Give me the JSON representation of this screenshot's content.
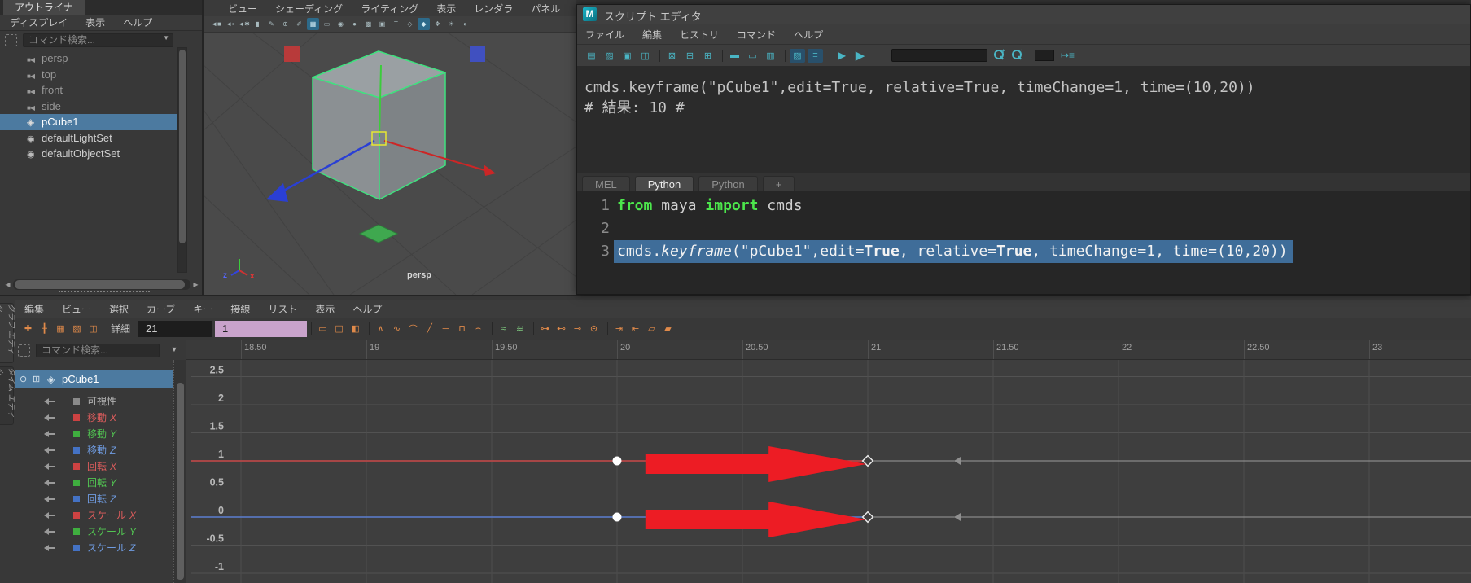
{
  "colors": {
    "selection_blue": "#4c7aa0",
    "code_selection": "#3f6d99",
    "keyword_green": "#4ce64c",
    "annotation_arrow_red": "#ed1c24",
    "curve_red": "#c84848",
    "curve_blue": "#5b7fd0",
    "icon_teal": "#4ab5c4",
    "icon_orange": "#e08a4a",
    "stat_field_purple": "#c9a3cb"
  },
  "outliner": {
    "tab": "アウトライナ",
    "menus": [
      "ディスプレイ",
      "表示",
      "ヘルプ"
    ],
    "search_placeholder": "コマンド検索...",
    "items": [
      {
        "label": "persp",
        "icon": "camera",
        "dim": true
      },
      {
        "label": "top",
        "icon": "camera",
        "dim": true
      },
      {
        "label": "front",
        "icon": "camera",
        "dim": true
      },
      {
        "label": "side",
        "icon": "camera",
        "dim": true
      },
      {
        "label": "pCube1",
        "icon": "mesh",
        "selected": true
      },
      {
        "label": "defaultLightSet",
        "icon": "set"
      },
      {
        "label": "defaultObjectSet",
        "icon": "set"
      }
    ]
  },
  "viewport": {
    "menus": [
      "ビュー",
      "シェーディング",
      "ライティング",
      "表示",
      "レンダラ",
      "パネル"
    ],
    "toolbar_icons": [
      {
        "name": "camera-select-icon",
        "glyph": "◄■"
      },
      {
        "name": "camera-lock-icon",
        "glyph": "◄▪"
      },
      {
        "name": "camera-attributes-icon",
        "glyph": "◄✱"
      },
      {
        "name": "bookmark-icon",
        "glyph": "▮"
      },
      {
        "name": "image-plane-icon",
        "glyph": "✎"
      },
      {
        "name": "pan-zoom-icon",
        "glyph": "⊕"
      },
      {
        "name": "grease-pencil-icon",
        "glyph": "✐"
      },
      {
        "name": "grid-icon",
        "glyph": "▦",
        "active": true
      },
      {
        "name": "film-gate-icon",
        "glyph": "▭"
      },
      {
        "name": "resolution-gate-icon",
        "glyph": "◉"
      },
      {
        "name": "gate-mask-icon",
        "glyph": "●"
      },
      {
        "name": "field-chart-icon",
        "glyph": "▩"
      },
      {
        "name": "safe-action-icon",
        "glyph": "▣"
      },
      {
        "name": "safe-title-icon",
        "glyph": "T"
      },
      {
        "name": "wireframe-cube-icon",
        "glyph": "◇"
      },
      {
        "name": "shaded-cube-icon",
        "glyph": "◆",
        "active": true
      },
      {
        "name": "textured-cube-icon",
        "glyph": "❖"
      },
      {
        "name": "use-all-lights-icon",
        "glyph": "☀"
      },
      {
        "name": "shadows-icon",
        "glyph": "◐"
      }
    ],
    "camera_label": "persp",
    "axis_labels": {
      "x": "x",
      "z": "z"
    }
  },
  "script_editor": {
    "title": "スクリプト エディタ",
    "menus": [
      "ファイル",
      "編集",
      "ヒストリ",
      "コマンド",
      "ヘルプ"
    ],
    "toolbar_icons": [
      {
        "name": "open-script-icon",
        "glyph": "▤"
      },
      {
        "name": "source-script-icon",
        "glyph": "▨"
      },
      {
        "name": "save-script-icon",
        "glyph": "▣"
      },
      {
        "name": "save-selected-icon",
        "glyph": "◫"
      },
      {
        "sep": true
      },
      {
        "name": "clear-history-icon",
        "glyph": "⊠"
      },
      {
        "name": "clear-input-icon",
        "glyph": "⊟"
      },
      {
        "name": "clear-all-icon",
        "glyph": "⊞"
      },
      {
        "sep": true
      },
      {
        "name": "echo-all-commands-icon",
        "glyph": "▬"
      },
      {
        "name": "suppress-results-icon",
        "glyph": "▭"
      },
      {
        "name": "suppress-info-icon",
        "glyph": "▥"
      },
      {
        "sep": true
      },
      {
        "name": "command-completion-icon",
        "glyph": "▧",
        "active": true
      },
      {
        "name": "line-numbers-icon",
        "glyph": "≡",
        "active": true
      },
      {
        "sep": true
      },
      {
        "name": "execute-line-icon",
        "glyph": "▶",
        "play": "small"
      },
      {
        "name": "execute-all-icon",
        "glyph": "▶",
        "play": "big"
      }
    ],
    "search_value": "",
    "history_lines": [
      "cmds.keyframe(\"pCube1\",edit=True, relative=True, timeChange=1, time=(10,20))",
      "# 結果: 10 #"
    ],
    "tabs": [
      {
        "label": "MEL"
      },
      {
        "label": "Python",
        "active": true
      },
      {
        "label": "Python"
      },
      {
        "label": "+"
      }
    ],
    "code_lines": [
      {
        "num": "1",
        "tokens": [
          {
            "t": "from",
            "s": "kw"
          },
          {
            "t": " maya ",
            "s": ""
          },
          {
            "t": "import",
            "s": "kw"
          },
          {
            "t": " cmds",
            "s": ""
          }
        ]
      },
      {
        "num": "2",
        "tokens": []
      },
      {
        "num": "3",
        "selected": true,
        "tokens": [
          {
            "t": "cmds.",
            "s": ""
          },
          {
            "t": "keyframe",
            "s": "it"
          },
          {
            "t": "(\"pCube1\",edit=",
            "s": ""
          },
          {
            "t": "True",
            "s": "b"
          },
          {
            "t": ", relative=",
            "s": ""
          },
          {
            "t": "True",
            "s": "b"
          },
          {
            "t": ", timeChange=1, time=(10,20))",
            "s": ""
          }
        ]
      }
    ]
  },
  "graph_editor": {
    "side_tabs": [
      {
        "label": "グラフ エディタ",
        "active": true
      },
      {
        "label": "タイム エディタ"
      }
    ],
    "menus": [
      "編集",
      "ビュー",
      "選択",
      "カーブ",
      "キー",
      "接線",
      "リスト",
      "表示",
      "ヘルプ"
    ],
    "toolbar": {
      "details_label": "詳細",
      "time_field": "21",
      "value_field": "1"
    },
    "toolbar_icons_left": [
      {
        "name": "move-key-tool-icon",
        "glyph": "✚"
      },
      {
        "name": "insert-key-tool-icon",
        "glyph": "╂"
      },
      {
        "name": "lattice-deform-icon",
        "glyph": "▦"
      },
      {
        "name": "region-key-tool-icon",
        "glyph": "▧"
      },
      {
        "name": "retime-tool-icon",
        "glyph": "◫"
      }
    ],
    "toolbar_icons_right": [
      {
        "name": "frame-all-icon",
        "glyph": "▭"
      },
      {
        "name": "frame-playback-icon",
        "glyph": "◫"
      },
      {
        "name": "center-current-time-icon",
        "glyph": "◧"
      },
      {
        "sep": true
      },
      {
        "name": "auto-tangent-icon",
        "glyph": "∧"
      },
      {
        "name": "spline-tangent-icon",
        "glyph": "∿"
      },
      {
        "name": "clamped-tangent-icon",
        "glyph": "⌒"
      },
      {
        "name": "linear-tangent-icon",
        "glyph": "╱"
      },
      {
        "name": "flat-tangent-icon",
        "glyph": "─"
      },
      {
        "name": "step-tangent-icon",
        "glyph": "⊓"
      },
      {
        "name": "plateau-tangent-icon",
        "glyph": "⌢"
      },
      {
        "sep": true
      },
      {
        "name": "buffer-snapshot-icon",
        "glyph": "≈",
        "green": true
      },
      {
        "name": "swap-buffer-icon",
        "glyph": "≋",
        "green": true
      },
      {
        "sep": true
      },
      {
        "name": "break-tangents-icon",
        "glyph": "⊶"
      },
      {
        "name": "unify-tangents-icon",
        "glyph": "⊷"
      },
      {
        "name": "free-tangent-weight-icon",
        "glyph": "⊸"
      },
      {
        "name": "lock-tangent-weight-icon",
        "glyph": "⊝"
      },
      {
        "sep": true
      },
      {
        "name": "time-snap-icon",
        "glyph": "⇥"
      },
      {
        "name": "value-snap-icon",
        "glyph": "⇤"
      },
      {
        "name": "template-channel-icon",
        "glyph": "▱"
      },
      {
        "name": "pin-channel-icon",
        "glyph": "▰"
      }
    ],
    "search_placeholder": "コマンド検索...",
    "tree": {
      "node_label": "pCube1",
      "attributes": [
        {
          "label": "可視性",
          "axis": "",
          "color": "#8a8a8a",
          "text": "#b0b0b0"
        },
        {
          "label": "移動",
          "axis": "X",
          "color": "#cc4242",
          "text": "#db5c5c"
        },
        {
          "label": "移動",
          "axis": "Y",
          "color": "#3fae3f",
          "text": "#52c552"
        },
        {
          "label": "移動",
          "axis": "Z",
          "color": "#4472c4",
          "text": "#6f9be0"
        },
        {
          "label": "回転",
          "axis": "X",
          "color": "#cc4242",
          "text": "#db5c5c"
        },
        {
          "label": "回転",
          "axis": "Y",
          "color": "#3fae3f",
          "text": "#52c552"
        },
        {
          "label": "回転",
          "axis": "Z",
          "color": "#4472c4",
          "text": "#6f9be0"
        },
        {
          "label": "スケール",
          "axis": "X",
          "color": "#cc4242",
          "text": "#db5c5c"
        },
        {
          "label": "スケール",
          "axis": "Y",
          "color": "#3fae3f",
          "text": "#52c552"
        },
        {
          "label": "スケール",
          "axis": "Z",
          "color": "#4472c4",
          "text": "#6f9be0"
        }
      ]
    }
  },
  "chart_data": {
    "type": "line",
    "title": "Graph Editor animation curves for pCube1",
    "x_ticks": [
      "18.50",
      "19",
      "19.50",
      "20",
      "20.50",
      "21",
      "21.50",
      "22",
      "22.50",
      "23"
    ],
    "y_ticks": [
      "2.5",
      "2",
      "1.5",
      "1",
      "0.5",
      "0",
      "-0.5",
      "-1"
    ],
    "x_range": [
      18.5,
      23.1
    ],
    "y_range": [
      -1.3,
      2.7
    ],
    "grid": true,
    "series": [
      {
        "name": "translate-x-curve",
        "color": "#c84848",
        "value": 1.0,
        "keyframes": [
          {
            "time": 20,
            "shape": "circle"
          },
          {
            "time": 21,
            "shape": "diamond"
          }
        ]
      },
      {
        "name": "translate-z-curve",
        "color": "#5b7fd0",
        "value": 0.0,
        "keyframes": [
          {
            "time": 20,
            "shape": "circle"
          },
          {
            "time": 21,
            "shape": "diamond"
          }
        ]
      }
    ],
    "annotations": [
      {
        "type": "red-arrow",
        "series": "translate-x-curve",
        "from_time": 20.1,
        "to_time": 20.9
      },
      {
        "type": "red-arrow",
        "series": "translate-z-curve",
        "from_time": 20.1,
        "to_time": 20.9
      }
    ]
  }
}
